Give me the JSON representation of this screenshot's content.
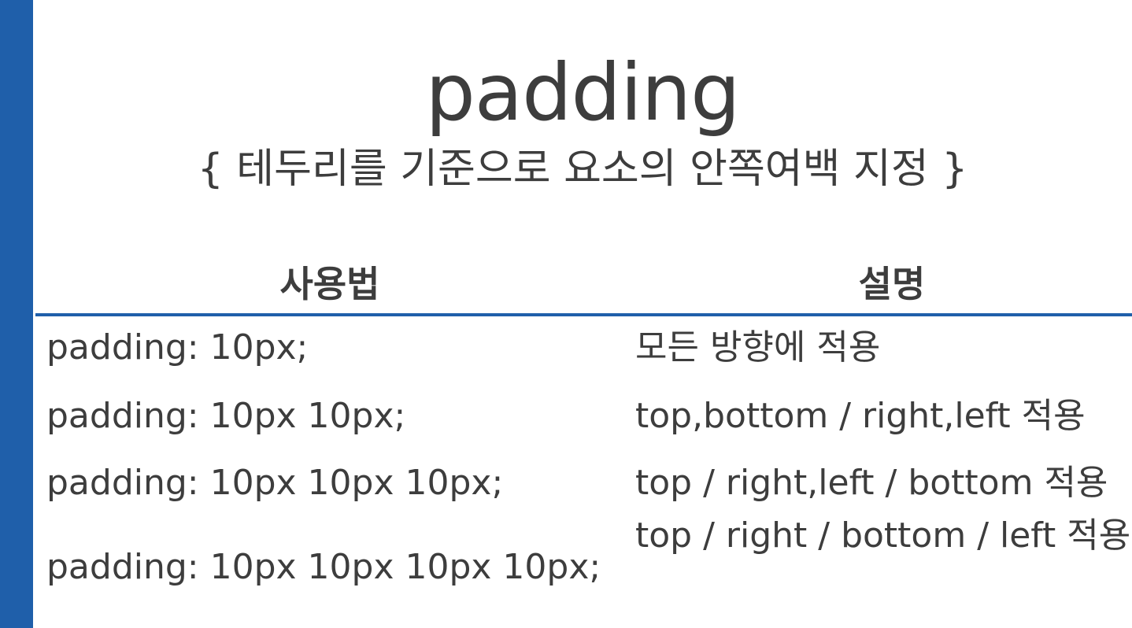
{
  "slide": {
    "title": "padding",
    "subtitle": "{ 테두리를 기준으로 요소의 안쪽여백 지정 }",
    "accent_color": "#1f5faa"
  },
  "table": {
    "headers": {
      "usage": "사용법",
      "description": "설명"
    },
    "rows": [
      {
        "usage": "padding: 10px;",
        "description": "모든 방향에 적용"
      },
      {
        "usage": "padding: 10px 10px;",
        "description": "top,bottom / right,left 적용"
      },
      {
        "usage": "padding: 10px 10px 10px;",
        "description": "top / right,left / bottom 적용"
      },
      {
        "usage": "padding: 10px 10px 10px 10px;",
        "description": "top / right / bottom / left 적용"
      }
    ]
  }
}
